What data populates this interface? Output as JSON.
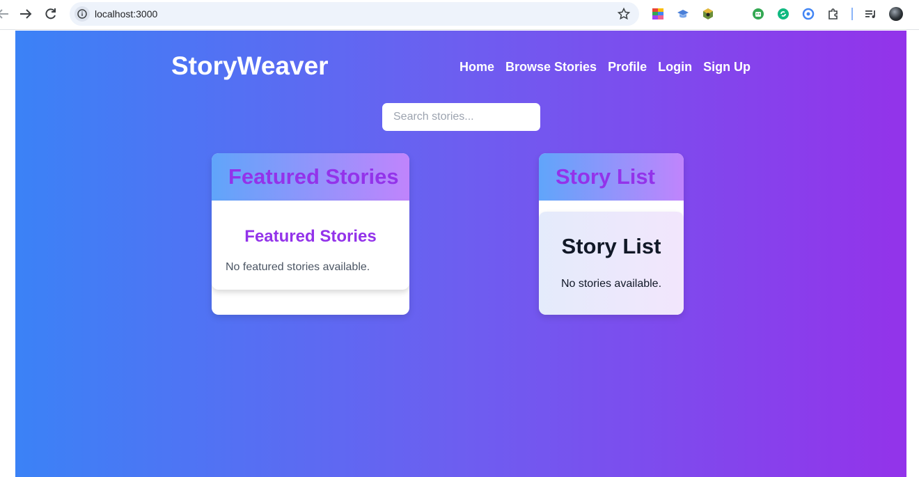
{
  "browser": {
    "url": "localhost:3000"
  },
  "site": {
    "logo": "StoryWeaver",
    "nav": [
      "Home",
      "Browse Stories",
      "Profile",
      "Login",
      "Sign Up"
    ],
    "search_placeholder": "Search stories..."
  },
  "featured": {
    "header": "Featured Stories",
    "title": "Featured Stories",
    "empty_message": "No featured stories available."
  },
  "story_list": {
    "header": "Story List",
    "title": "Story List",
    "empty_message": "No stories available."
  },
  "colors": {
    "gradient_start": "#3b82f6",
    "gradient_end": "#9333ea",
    "accent": "#9333ea"
  },
  "icons": {
    "back": "arrow-left-icon",
    "forward": "arrow-right-icon",
    "reload": "reload-icon",
    "site_info": "info-icon",
    "bookmark": "star-icon",
    "extensions": "puzzle-icon",
    "media": "media-control-icon",
    "profile": "avatar"
  }
}
